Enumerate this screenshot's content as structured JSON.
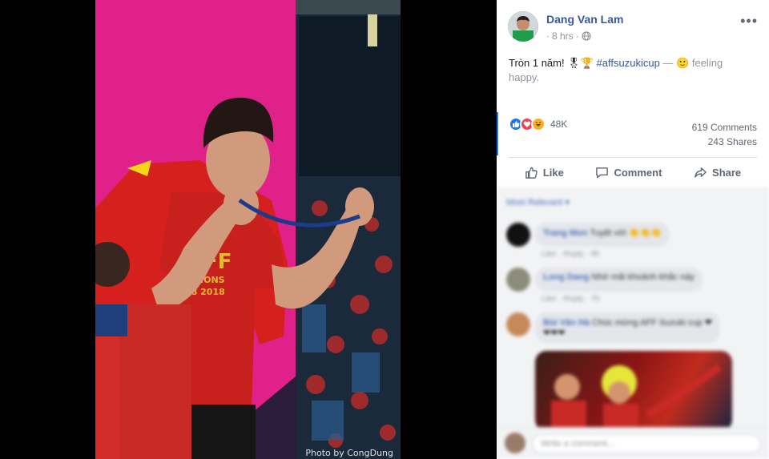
{
  "photo": {
    "credit": "Photo by CongDung",
    "shirt_text_1": "FF",
    "shirt_text_2": "MPIONS",
    "shirt_text_3": "08 2018"
  },
  "post": {
    "author": "Dang Van Lam",
    "time": "8 hrs",
    "privacy_icon": "globe-icon",
    "more_icon": "more-options-icon",
    "text_main": "Tròn 1 năm! ",
    "emoji_medal": "🎖",
    "emoji_trophy": "🏆",
    "hashtag": "#affsuzukicup",
    "feeling_sep": " — ",
    "feeling_emoji": "🙂",
    "feeling_text": " feeling happy."
  },
  "reactions": {
    "count": "48K",
    "comments": "619 Comments",
    "shares": "243 Shares"
  },
  "actions": {
    "like": "Like",
    "comment": "Comment",
    "share": "Share"
  },
  "comments": {
    "sort_label": "Most Relevant ▾",
    "items": [
      {
        "name": "Trang Mon",
        "text": "Tuyệt vời 👏👏👏",
        "meta": "Like · Reply · 8h"
      },
      {
        "name": "Long Dang",
        "text": "Nhớ mãi khoảnh khắc này",
        "meta": "Like · Reply · 7h"
      },
      {
        "name": "Bùi Văn Hà",
        "text": "Chúc mừng AFF Suzuki cup ❤",
        "meta": "❤❤❤"
      }
    ],
    "write_placeholder": "Write a comment..."
  },
  "colors": {
    "accent": "#385898",
    "like_blue": "#1877f2",
    "love_red": "#f33e58",
    "haha_yellow": "#f7b125",
    "backdrop_pink": "#e0218a"
  }
}
